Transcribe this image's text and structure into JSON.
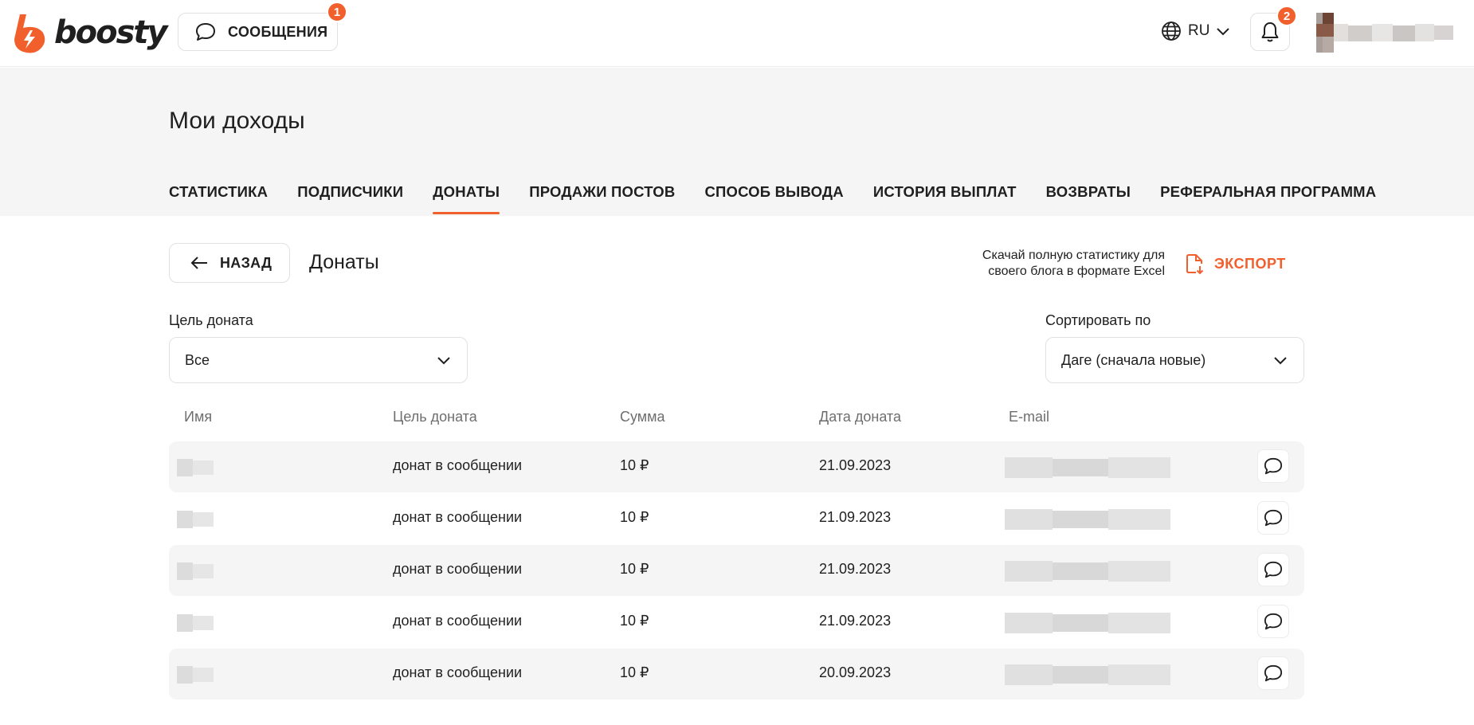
{
  "header": {
    "logo_text": "boosty",
    "messages_label": "СООБЩЕНИЯ",
    "messages_badge": "1",
    "language": "RU",
    "notifications_badge": "2"
  },
  "page": {
    "title": "Мои доходы",
    "tabs": [
      {
        "label": "СТАТИСТИКА",
        "active": false
      },
      {
        "label": "ПОДПИСЧИКИ",
        "active": false
      },
      {
        "label": "ДОНАТЫ",
        "active": true
      },
      {
        "label": "ПРОДАЖИ ПОСТОВ",
        "active": false
      },
      {
        "label": "СПОСОБ ВЫВОДА",
        "active": false
      },
      {
        "label": "ИСТОРИЯ ВЫПЛАТ",
        "active": false
      },
      {
        "label": "ВОЗВРАТЫ",
        "active": false
      },
      {
        "label": "РЕФЕРАЛЬНАЯ ПРОГРАММА",
        "active": false
      }
    ]
  },
  "toolbar": {
    "back_label": "НАЗАД",
    "section_title": "Донаты",
    "export_hint_line1": "Скачай полную статистику для",
    "export_hint_line2": "своего блога в формате Excel",
    "export_label": "ЭКСПОРТ"
  },
  "filters": {
    "goal_label": "Цель доната",
    "goal_value": "Все",
    "sort_label": "Сортировать по",
    "sort_value": "Даге (сначала новые)"
  },
  "table": {
    "headers": [
      "Имя",
      "Цель доната",
      "Сумма",
      "Дата доната",
      "E-mail"
    ],
    "rows": [
      {
        "goal": "донат в сообщении",
        "amount": "10 ₽",
        "date": "21.09.2023"
      },
      {
        "goal": "донат в сообщении",
        "amount": "10 ₽",
        "date": "21.09.2023"
      },
      {
        "goal": "донат в сообщении",
        "amount": "10 ₽",
        "date": "21.09.2023"
      },
      {
        "goal": "донат в сообщении",
        "amount": "10 ₽",
        "date": "21.09.2023"
      },
      {
        "goal": "донат в сообщении",
        "amount": "10 ₽",
        "date": "20.09.2023"
      }
    ]
  },
  "colors": {
    "accent": "#f15f2c",
    "band_bg": "#f5f5f5",
    "text": "#1f1f1f",
    "muted": "#6e6e6e"
  }
}
